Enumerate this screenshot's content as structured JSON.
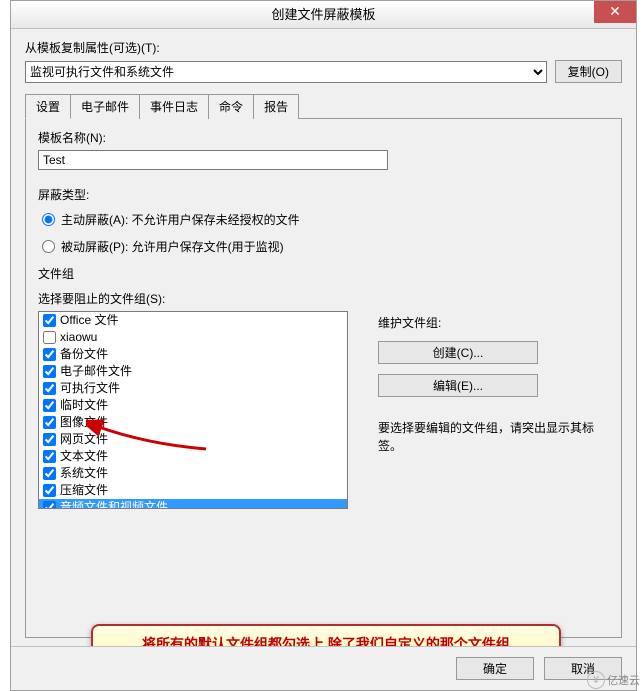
{
  "window": {
    "title": "创建文件屏蔽模板",
    "close": "✕"
  },
  "copyFrom": {
    "label": "从模板复制属性(可选)(T):",
    "selected": "监视可执行文件和系统文件",
    "copyBtn": "复制(O)"
  },
  "tabs": {
    "settings": "设置",
    "email": "电子邮件",
    "eventlog": "事件日志",
    "command": "命令",
    "report": "报告"
  },
  "template": {
    "nameLabel": "模板名称(N):",
    "nameValue": "Test"
  },
  "screeningType": {
    "label": "屏蔽类型:",
    "active": "主动屏蔽(A): 不允许用户保存未经授权的文件",
    "passive": "被动屏蔽(P): 允许用户保存文件(用于监视)"
  },
  "fileGroups": {
    "header": "文件组",
    "selectLabel": "选择要阻止的文件组(S):",
    "items": [
      {
        "label": "Office 文件",
        "checked": true,
        "selected": false
      },
      {
        "label": "xiaowu",
        "checked": false,
        "selected": false
      },
      {
        "label": "备份文件",
        "checked": true,
        "selected": false
      },
      {
        "label": "电子邮件文件",
        "checked": true,
        "selected": false
      },
      {
        "label": "可执行文件",
        "checked": true,
        "selected": false
      },
      {
        "label": "临时文件",
        "checked": true,
        "selected": false
      },
      {
        "label": "图像文件",
        "checked": true,
        "selected": false
      },
      {
        "label": "网页文件",
        "checked": true,
        "selected": false
      },
      {
        "label": "文本文件",
        "checked": true,
        "selected": false
      },
      {
        "label": "系统文件",
        "checked": true,
        "selected": false
      },
      {
        "label": "压缩文件",
        "checked": true,
        "selected": false
      },
      {
        "label": "音频文件和视频文件",
        "checked": true,
        "selected": true
      }
    ],
    "maintainLabel": "维护文件组:",
    "createBtn": "创建(C)...",
    "editBtn": "编辑(E)...",
    "hint": "要选择要编辑的文件组，请突出显示其标签。"
  },
  "annotation": "将所有的默认文件组都勾选上,除了我们自定义的那个文件组",
  "footer": {
    "ok": "确定",
    "cancel": "取消"
  },
  "watermark": "亿速云"
}
